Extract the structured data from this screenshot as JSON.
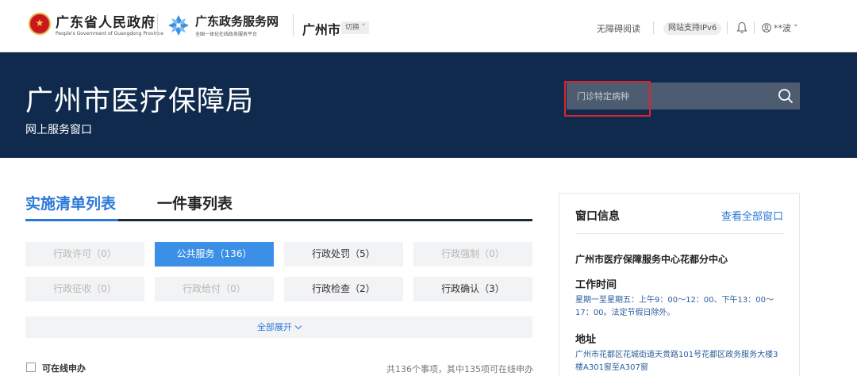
{
  "header": {
    "gov_name": "广东省人民政府",
    "gov_name_en": "People's Government of Guangdong Province",
    "service_name": "广东政务服务网",
    "service_subtitle": "全国一体化在线政务服务平台",
    "city": "广州市",
    "switch_label": "切换",
    "accessibility_label": "无障碍阅读",
    "ipv6_label": "网站支持IPv6",
    "username": "**波"
  },
  "banner": {
    "title": "广州市医疗保障局",
    "subtitle": "网上服务窗口",
    "search_placeholder": "门诊特定病种"
  },
  "tabs": [
    {
      "label": "实施清单列表"
    },
    {
      "label": "一件事列表"
    }
  ],
  "categories": [
    {
      "label": "行政许可（0）"
    },
    {
      "label": "公共服务（136）"
    },
    {
      "label": "行政处罚（5）"
    },
    {
      "label": "行政强制（0）"
    },
    {
      "label": "行政征收（0）"
    },
    {
      "label": "行政给付（0）"
    },
    {
      "label": "行政检查（2）"
    },
    {
      "label": "行政确认（3）"
    }
  ],
  "expand_label": "全部展开",
  "filter": {
    "online_label": "可在线申办",
    "summary": "共136个事项，其中135项可在线申办"
  },
  "window_info": {
    "heading": "窗口信息",
    "view_all": "查看全部窗口",
    "center_name": "广州市医疗保障服务中心花都分中心",
    "hours_label": "工作时间",
    "hours_text": "星期一至星期五：上午9：00～12：00、下午13：00～17：00。法定节假日除外。",
    "address_label": "地址",
    "address_text": "广州市花都区花城街道天贵路101号花都区政务服务大楼3楼A301窗至A307窗"
  },
  "colors": {
    "banner_bg": "#0f2a4d",
    "accent": "#2b78d8",
    "active_category": "#3b8fe6",
    "highlight": "#e0232b"
  }
}
